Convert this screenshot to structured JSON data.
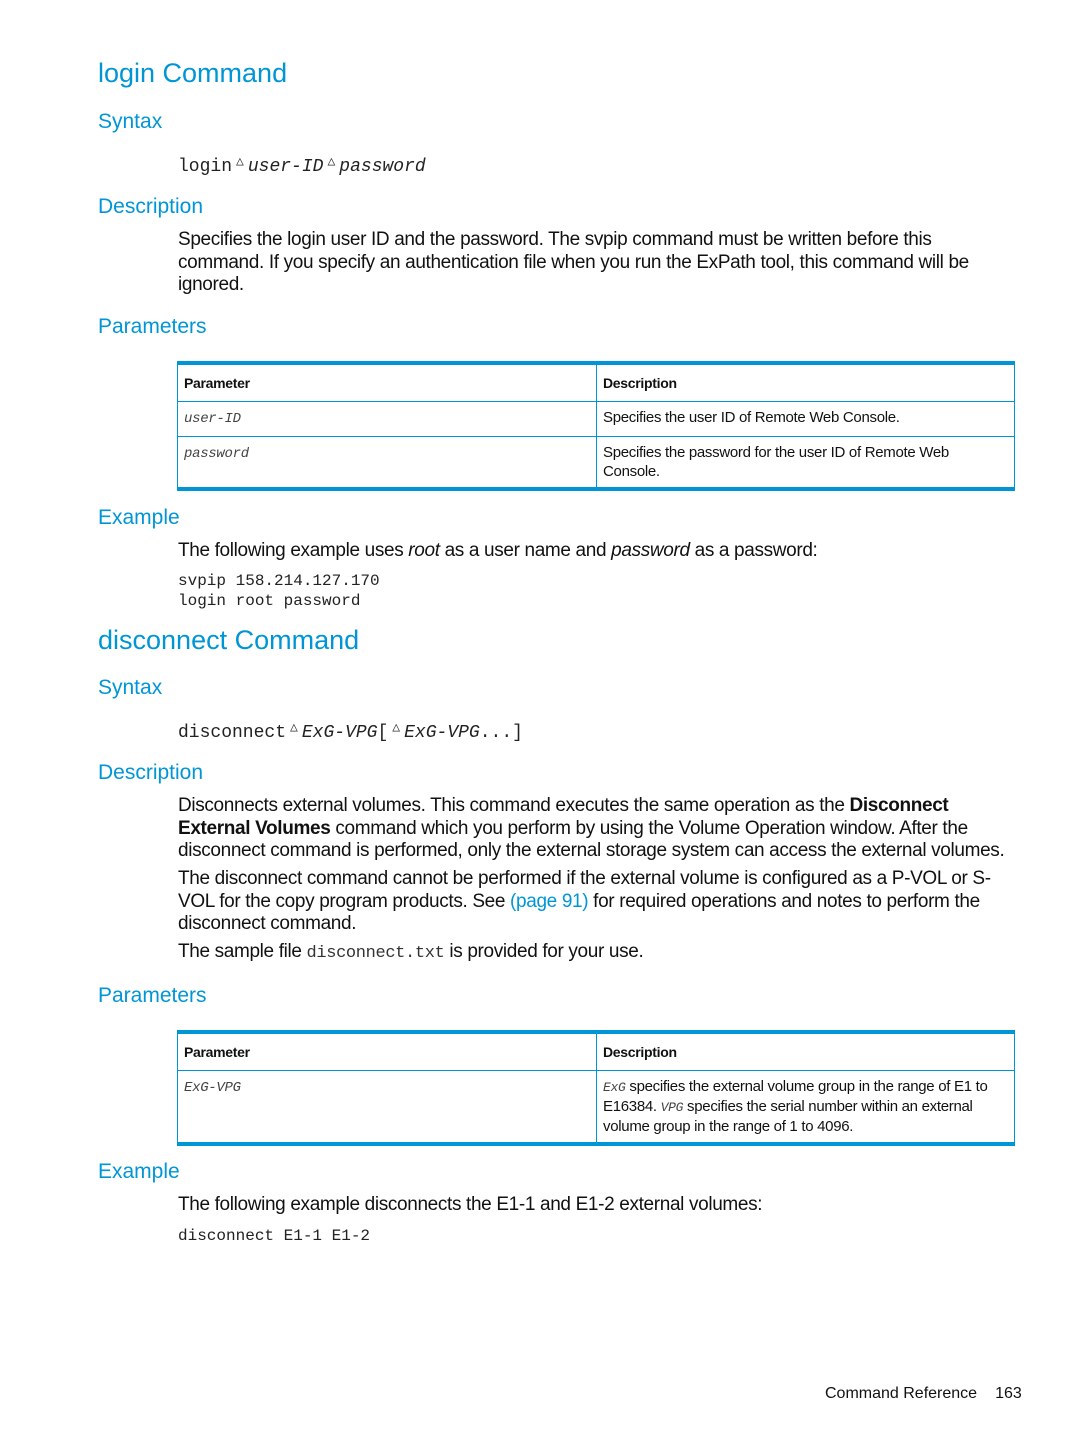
{
  "login": {
    "title": "login Command",
    "syntax_heading": "Syntax",
    "syntax": {
      "command": "login",
      "arg1": "user-ID",
      "arg2": "password",
      "separator_icon": "space-triangle-icon"
    },
    "description_heading": "Description",
    "description": "Specifies the login user ID and the password. The svpip command must be written before this command. If you specify an authentication file when you run the ExPath tool, this command will be ignored.",
    "parameters_heading": "Parameters",
    "table": {
      "headers": [
        "Parameter",
        "Description"
      ],
      "rows": [
        {
          "param": "user-ID",
          "desc": "Specifies the user ID of Remote Web Console."
        },
        {
          "param": "password",
          "desc": "Specifies the password for the user ID of Remote Web Console."
        }
      ]
    },
    "example_heading": "Example",
    "example_intro": {
      "p1": "The following example uses ",
      "em1": "root",
      "p2": " as a user name and ",
      "em2": "password",
      "p3": " as a password:"
    },
    "example_code": [
      "svpip 158.214.127.170",
      "login root password"
    ]
  },
  "disconnect": {
    "title": "disconnect Command",
    "syntax_heading": "Syntax",
    "syntax": {
      "command": "disconnect",
      "arg1": "ExG-VPG",
      "open_bracket": "[",
      "arg2": "ExG-VPG",
      "tail": "...]",
      "separator_icon": "space-triangle-icon"
    },
    "description_heading": "Description",
    "description1": {
      "p1": "Disconnects external volumes. This command executes the same operation as the ",
      "bold": "Disconnect External Volumes",
      "p2": " command which you perform by using the Volume Operation window. After the disconnect command is performed, only the external storage system can access the external volumes."
    },
    "description2": {
      "p1": "The disconnect command cannot be performed if the external volume is configured as a P-VOL or S-VOL for the copy program products. See ",
      "link": "(page 91)",
      "p2": " for required operations and notes to perform the disconnect command."
    },
    "description3": {
      "p1": "The sample file ",
      "code": "disconnect.txt",
      "p2": " is provided for your use."
    },
    "parameters_heading": "Parameters",
    "table": {
      "headers": [
        "Parameter",
        "Description"
      ],
      "rows": [
        {
          "param": "ExG-VPG",
          "desc_code1": "ExG",
          "desc_p1": " specifies the external volume group in the range of E1 to E16384. ",
          "desc_code2": "VPG",
          "desc_p2": " specifies the serial number within an external volume group in the range of 1 to 4096."
        }
      ]
    },
    "example_heading": "Example",
    "example_intro": "The following example disconnects the E1-1 and E1-2 external volumes:",
    "example_code": [
      "disconnect E1-1 E1-2"
    ]
  },
  "footer": {
    "section": "Command Reference",
    "page": "163"
  }
}
